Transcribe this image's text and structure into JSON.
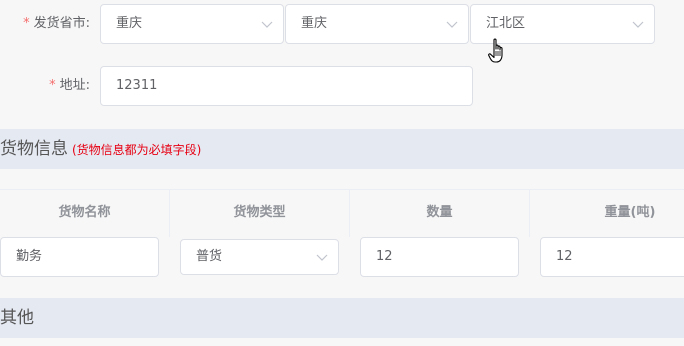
{
  "shipping": {
    "label": "发货省市:",
    "province": "重庆",
    "city": "重庆",
    "district": "江北区"
  },
  "address": {
    "label": "地址:",
    "value": "12311"
  },
  "goods_section": {
    "title": "货物信息",
    "note": "(货物信息都为必填字段)"
  },
  "table": {
    "headers": [
      "货物名称",
      "货物类型",
      "数量",
      "重量(吨)"
    ],
    "row": {
      "name": "勤务",
      "type": "普货",
      "quantity": "12",
      "weight": "12"
    }
  },
  "other_section": {
    "title": "其他"
  },
  "icons": {
    "chevron": "chevron-down-icon",
    "cursor": "hand-pointer-icon"
  }
}
